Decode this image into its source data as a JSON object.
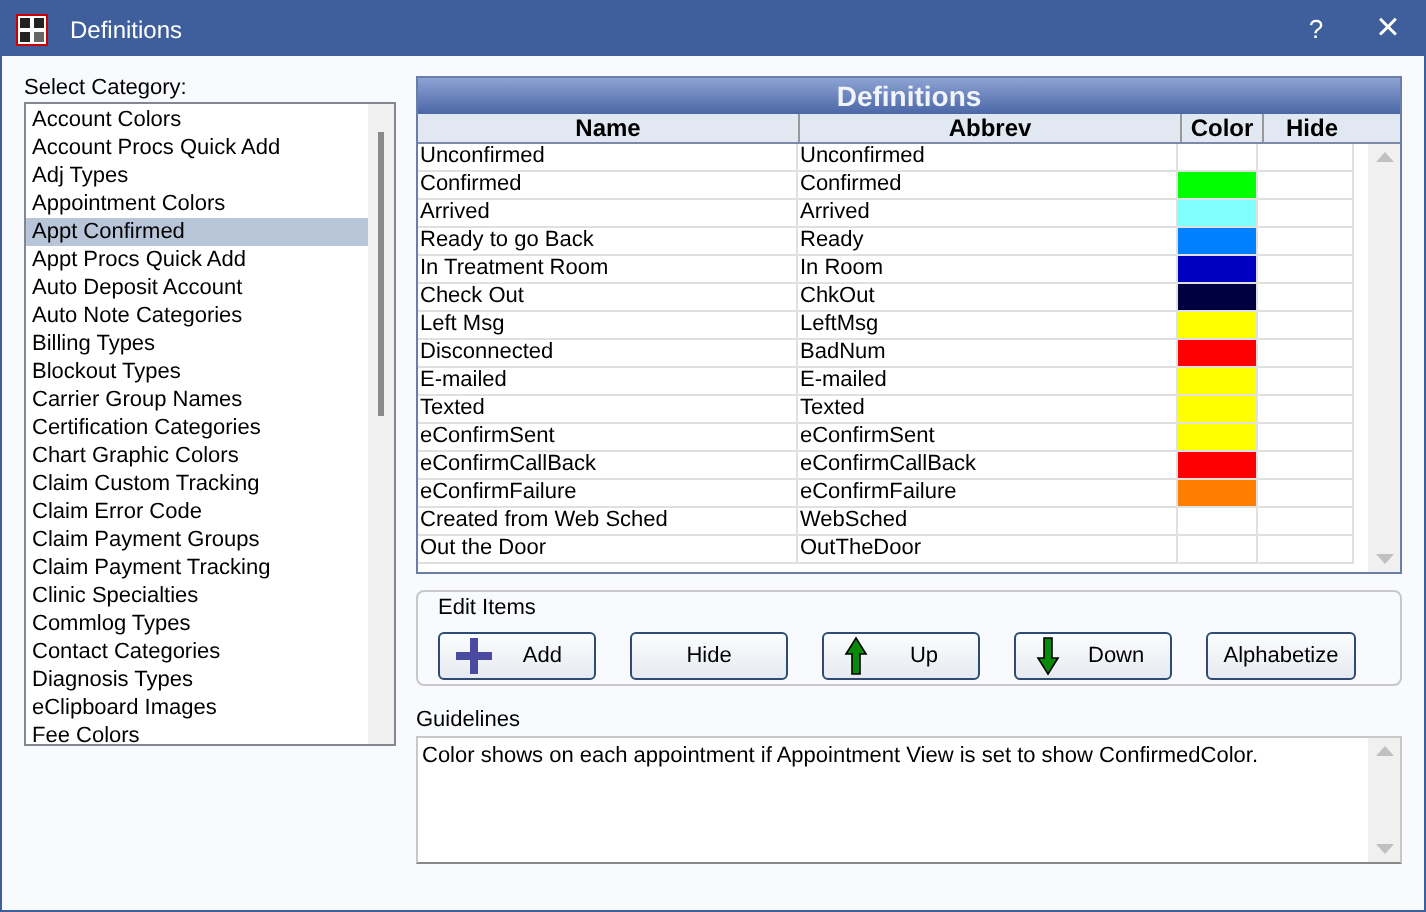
{
  "window": {
    "title": "Definitions",
    "buttons": [
      "?",
      "×"
    ]
  },
  "category": {
    "label": "Select Category:",
    "items": [
      {
        "label": "Account Colors",
        "selected": false
      },
      {
        "label": "Account Procs Quick Add",
        "selected": false
      },
      {
        "label": "Adj Types",
        "selected": false
      },
      {
        "label": "Appointment Colors",
        "selected": false
      },
      {
        "label": "Appt Confirmed",
        "selected": true
      },
      {
        "label": "Appt Procs Quick Add",
        "selected": false
      },
      {
        "label": "Auto Deposit Account",
        "selected": false
      },
      {
        "label": "Auto Note Categories",
        "selected": false
      },
      {
        "label": "Billing Types",
        "selected": false
      },
      {
        "label": "Blockout Types",
        "selected": false
      },
      {
        "label": "Carrier Group Names",
        "selected": false
      },
      {
        "label": "Certification Categories",
        "selected": false
      },
      {
        "label": "Chart Graphic Colors",
        "selected": false
      },
      {
        "label": "Claim Custom Tracking",
        "selected": false
      },
      {
        "label": "Claim Error Code",
        "selected": false
      },
      {
        "label": "Claim Payment Groups",
        "selected": false
      },
      {
        "label": "Claim Payment Tracking",
        "selected": false
      },
      {
        "label": "Clinic Specialties",
        "selected": false
      },
      {
        "label": "Commlog Types",
        "selected": false
      },
      {
        "label": "Contact Categories",
        "selected": false
      },
      {
        "label": "Diagnosis Types",
        "selected": false
      },
      {
        "label": "eClipboard Images",
        "selected": false
      },
      {
        "label": "Fee Colors",
        "selected": false
      }
    ]
  },
  "definitions": {
    "title": "Definitions",
    "columns": [
      "Name",
      "Abbrev",
      "Color",
      "Hide"
    ],
    "rows": [
      {
        "name": "Unconfirmed",
        "abbrev": "Unconfirmed"
      },
      {
        "name": "Confirmed",
        "abbrev": "Confirmed",
        "color": "#00ff00"
      },
      {
        "name": "Arrived",
        "abbrev": "Arrived",
        "color": "#80ffff"
      },
      {
        "name": "Ready to go Back",
        "abbrev": "Ready",
        "color": "#0080ff"
      },
      {
        "name": "In Treatment Room",
        "abbrev": "In Room",
        "color": "#0000c0"
      },
      {
        "name": "Check Out",
        "abbrev": "ChkOut",
        "color": "#000040"
      },
      {
        "name": "Left Msg",
        "abbrev": "LeftMsg",
        "color": "#ffff00"
      },
      {
        "name": "Disconnected",
        "abbrev": "BadNum",
        "color": "#ff0000"
      },
      {
        "name": "E-mailed",
        "abbrev": "E-mailed",
        "color": "#ffff00"
      },
      {
        "name": "Texted",
        "abbrev": "Texted",
        "color": "#ffff00"
      },
      {
        "name": "eConfirmSent",
        "abbrev": "eConfirmSent",
        "color": "#ffff00"
      },
      {
        "name": "eConfirmCallBack",
        "abbrev": "eConfirmCallBack",
        "color": "#ff0000"
      },
      {
        "name": "eConfirmFailure",
        "abbrev": "eConfirmFailure",
        "color": "#ff8000"
      },
      {
        "name": "Created from Web Sched",
        "abbrev": "WebSched"
      },
      {
        "name": "Out the Door",
        "abbrev": "OutTheDoor"
      }
    ]
  },
  "edit_items": {
    "label": "Edit Items",
    "buttons": [
      {
        "label": "Add",
        "kind": "add"
      },
      {
        "label": "Hide",
        "kind": "plain"
      },
      {
        "label": "Up",
        "kind": "up"
      },
      {
        "label": "Down",
        "kind": "down"
      },
      {
        "label": "Alphabetize",
        "kind": "plain"
      }
    ]
  },
  "guidelines": {
    "label": "Guidelines",
    "text": "Color shows on each appointment if Appointment View is set to show ConfirmedColor."
  }
}
